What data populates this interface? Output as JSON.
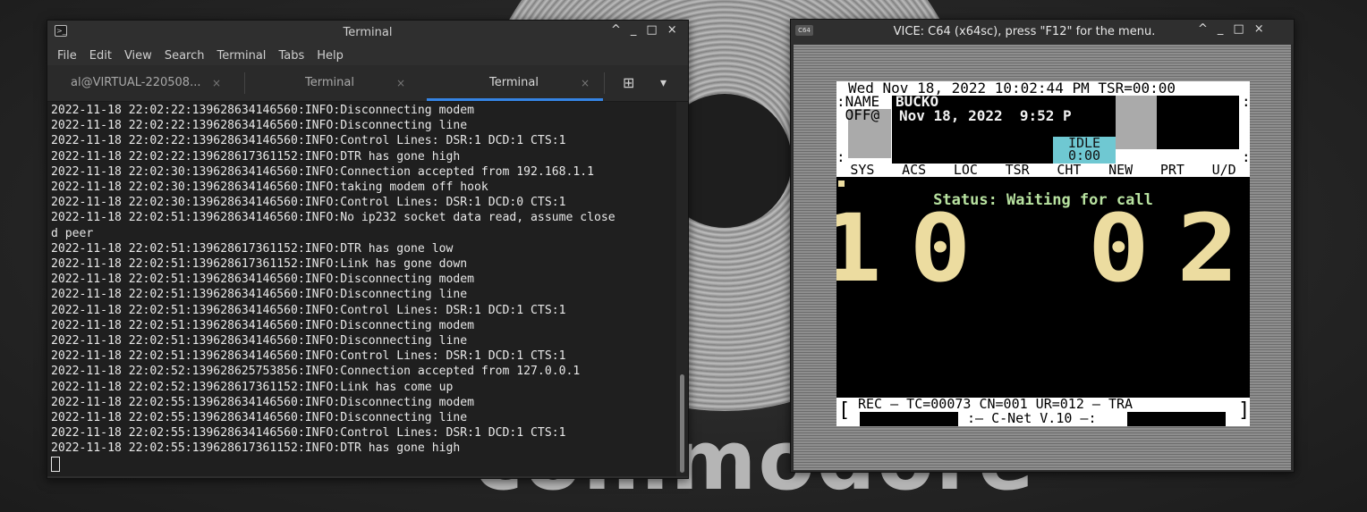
{
  "wallpaper": {
    "word": "commodore"
  },
  "terminal": {
    "title": "Terminal",
    "controls": [
      "^",
      "_",
      "□",
      "×"
    ],
    "menu": [
      "File",
      "Edit",
      "View",
      "Search",
      "Terminal",
      "Tabs",
      "Help"
    ],
    "tabs": [
      {
        "label": "al@VIRTUAL-220508..."
      },
      {
        "label": "Terminal"
      },
      {
        "label": "Terminal"
      }
    ],
    "tab_close": "×",
    "new_tab_icon": "⊞",
    "tabs_menu_icon": "▾",
    "lines": [
      "2022-11-18 22:02:22:139628634146560:INFO:Disconnecting modem",
      "2022-11-18 22:02:22:139628634146560:INFO:Disconnecting line",
      "2022-11-18 22:02:22:139628634146560:INFO:Control Lines: DSR:1 DCD:1 CTS:1",
      "2022-11-18 22:02:22:139628617361152:INFO:DTR has gone high",
      "2022-11-18 22:02:30:139628634146560:INFO:Connection accepted from 192.168.1.1",
      "2022-11-18 22:02:30:139628634146560:INFO:taking modem off hook",
      "2022-11-18 22:02:30:139628634146560:INFO:Control Lines: DSR:1 DCD:0 CTS:1",
      "2022-11-18 22:02:51:139628634146560:INFO:No ip232 socket data read, assume close",
      "d peer",
      "2022-11-18 22:02:51:139628617361152:INFO:DTR has gone low",
      "2022-11-18 22:02:51:139628617361152:INFO:Link has gone down",
      "2022-11-18 22:02:51:139628634146560:INFO:Disconnecting modem",
      "2022-11-18 22:02:51:139628634146560:INFO:Disconnecting line",
      "2022-11-18 22:02:51:139628634146560:INFO:Control Lines: DSR:1 DCD:1 CTS:1",
      "2022-11-18 22:02:51:139628634146560:INFO:Disconnecting modem",
      "2022-11-18 22:02:51:139628634146560:INFO:Disconnecting line",
      "2022-11-18 22:02:51:139628634146560:INFO:Control Lines: DSR:1 DCD:1 CTS:1",
      "2022-11-18 22:02:52:139628625753856:INFO:Connection accepted from 127.0.0.1",
      "2022-11-18 22:02:52:139628617361152:INFO:Link has come up",
      "2022-11-18 22:02:55:139628634146560:INFO:Disconnecting modem",
      "2022-11-18 22:02:55:139628634146560:INFO:Disconnecting line",
      "2022-11-18 22:02:55:139628634146560:INFO:Control Lines: DSR:1 DCD:1 CTS:1",
      "2022-11-18 22:02:55:139628617361152:INFO:DTR has gone high"
    ]
  },
  "vice": {
    "icon_label": "C64",
    "title": "VICE: C64 (x64sc), press \"F12\" for the menu.",
    "controls": [
      "^",
      "_",
      "□",
      "×"
    ],
    "screen": {
      "header_line": "Wed Nov 18, 2022 10:02:44 PM TSR=00:00",
      "name_label": ":NAME",
      "name_value": "BUCKO",
      "off_label": " OFF@",
      "last_on": "Nov 18, 2022  9:52 P",
      "idle_label": "IDLE",
      "idle_time": "0:00",
      "colon_left": ":",
      "colon_right": ":",
      "menu": [
        "SYS",
        "ACS",
        "LOC",
        "TSR",
        "CHT",
        "NEW",
        "PRT",
        "U/D"
      ],
      "status": "Status: Waiting for call",
      "clock": "10 02",
      "footer_left": "[",
      "footer_line1": "REC — TC=00073 CN=001 UR=012 — TRA",
      "footer_line2": ":— C-Net V.10 —:",
      "footer_right": "]"
    }
  }
}
